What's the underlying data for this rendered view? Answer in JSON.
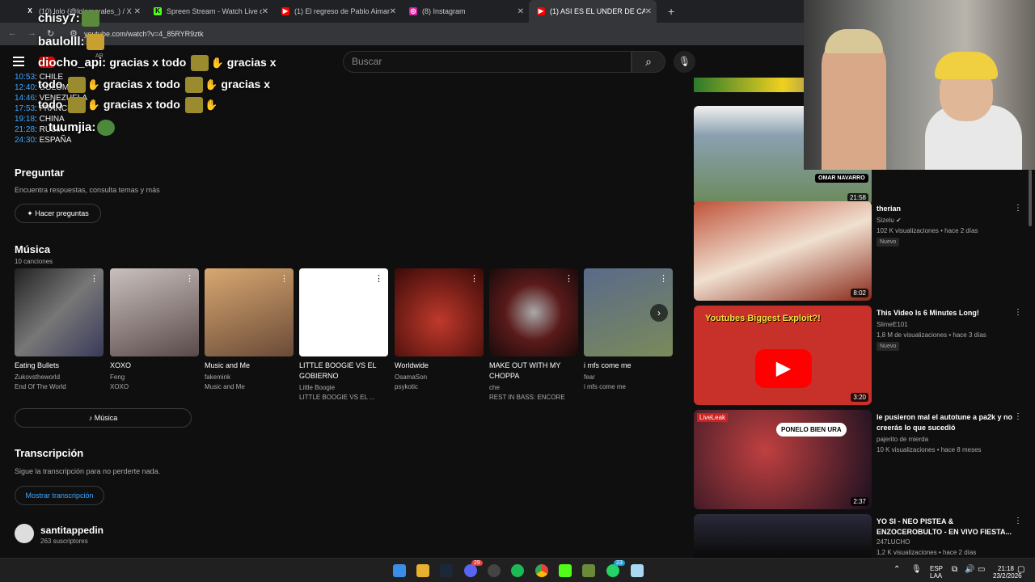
{
  "browser": {
    "tabs": [
      {
        "label": "(10) lolo (@lolomorales_) / X",
        "fav": "X",
        "color": "#000000"
      },
      {
        "label": "Spreen Stream - Watch Live on",
        "fav": "K",
        "color": "#53fc18"
      },
      {
        "label": "(1) El regreso de Pablo Aimar a",
        "fav": "▶",
        "color": "#ff0000"
      },
      {
        "label": "(8) Instagram",
        "fav": "◎",
        "color": "#d6249f"
      },
      {
        "label": "(1) ASI ES EL UNDER DE CADA",
        "fav": "▶",
        "color": "#ff0000"
      }
    ],
    "new_tab": "+",
    "url": "youtube.com/watch?v=4_85RYR9ztk"
  },
  "header": {
    "search_placeholder": "Buscar",
    "logo_region": "AR"
  },
  "chat": [
    {
      "user": "chisy7:",
      "msg": ""
    },
    {
      "user": "baulolll:",
      "msg": ""
    },
    {
      "user": "diocho_api:",
      "msg": "gracias x todo",
      "msg2": "gracias x"
    },
    {
      "user": "",
      "msg": "todo",
      "msg2": "gracias x todo",
      "msg3": "gracias x"
    },
    {
      "user": "",
      "msg": "todo",
      "msg2": "gracias x todo"
    },
    {
      "user": "tuumjia:",
      "msg": ""
    }
  ],
  "chapters": [
    {
      "time": "10:53",
      "label": "CHILE"
    },
    {
      "time": "12:40",
      "label": "COLOMBIA"
    },
    {
      "time": "14:46",
      "label": "VENEZUELA"
    },
    {
      "time": "17:53",
      "label": "FRANCIA"
    },
    {
      "time": "19:18",
      "label": "CHINA"
    },
    {
      "time": "21:28",
      "label": "RUSIA"
    },
    {
      "time": "24:30",
      "label": "ESPAÑA"
    }
  ],
  "ask": {
    "title": "Preguntar",
    "subtitle": "Encuentra respuestas, consulta temas y más",
    "button": "Hacer preguntas"
  },
  "music": {
    "title": "Música",
    "count": "10 canciones",
    "button": "Música",
    "cards": [
      {
        "title": "Eating Bullets",
        "artist": "Zukovstheworld",
        "album": "End Of The World",
        "bg": "#555"
      },
      {
        "title": "XOXO",
        "artist": "Feng",
        "album": "XOXO",
        "bg": "#8a7b78"
      },
      {
        "title": "Music and Me",
        "artist": "fakemink",
        "album": "Music and Me",
        "bg": "#b8885a"
      },
      {
        "title": "LITTLE BOOGIE VS EL GOBIERNO",
        "artist": "Little Boogie",
        "album": "LITTLE BOOGIE VS EL ...",
        "bg": "#ffffff"
      },
      {
        "title": "Worldwide",
        "artist": "OsamaSon",
        "album": "psykotic",
        "bg": "#8a1a12"
      },
      {
        "title": "MAKE OUT WITH MY CHOPPA",
        "artist": "che",
        "album": "REST IN BASS: ENCORE",
        "bg": "#2a1010"
      },
      {
        "title": "i mfs come me",
        "artist": "fear",
        "album": "i mfs come me",
        "bg": "#6e7a5a"
      }
    ]
  },
  "transcript": {
    "title": "Transcripción",
    "subtitle": "Sigue la transcripción para no perderte nada.",
    "button": "Mostrar transcripción"
  },
  "channel": {
    "name": "santitappedin",
    "subs": "263 suscriptores"
  },
  "sidebar": {
    "videos": [
      {
        "title": "",
        "channel": "",
        "meta": "",
        "badge": "",
        "duration": "21:58",
        "overlay": "OMAR NAVARRO",
        "bg": "#6b7b6a"
      },
      {
        "title": "therian",
        "channel": "Sizelu",
        "meta": "102 K visualizaciones • hace 2 días",
        "badge": "Nuevo",
        "duration": "8:02",
        "bg": "#c0533a"
      },
      {
        "title": "This Video Is 6 Minutes Long!",
        "channel": "SlimeE101",
        "meta": "1,8 M de visualizaciones • hace 3 días",
        "badge": "Nuevo",
        "duration": "3:20",
        "bg": "#d9332b",
        "overlay": "Youtubes Biggest Exploit?!"
      },
      {
        "title": "le pusieron mal el autotune a pa2k y no creerás lo que sucedió",
        "channel": "pajerito de mierda",
        "meta": "10 K visualizaciones • hace 8 meses",
        "badge": "",
        "duration": "2:37",
        "bg": "#2a2030",
        "overlay": "PONELO BIEN URA",
        "tag": "LiveLeak"
      },
      {
        "title": "YO SI - NEO PISTEA & ENZOCEROBULTO - EN VIVO FIESTA...",
        "channel": "247LUCHO",
        "meta": "1,2 K visualizaciones • hace 2 días",
        "badge": "",
        "duration": "",
        "bg": "#1a1a22"
      }
    ]
  },
  "taskbar": {
    "lang": "ESP",
    "region": "LAA",
    "time": "21:18",
    "date": "23/2/2026",
    "badges": [
      "29",
      "23"
    ]
  }
}
